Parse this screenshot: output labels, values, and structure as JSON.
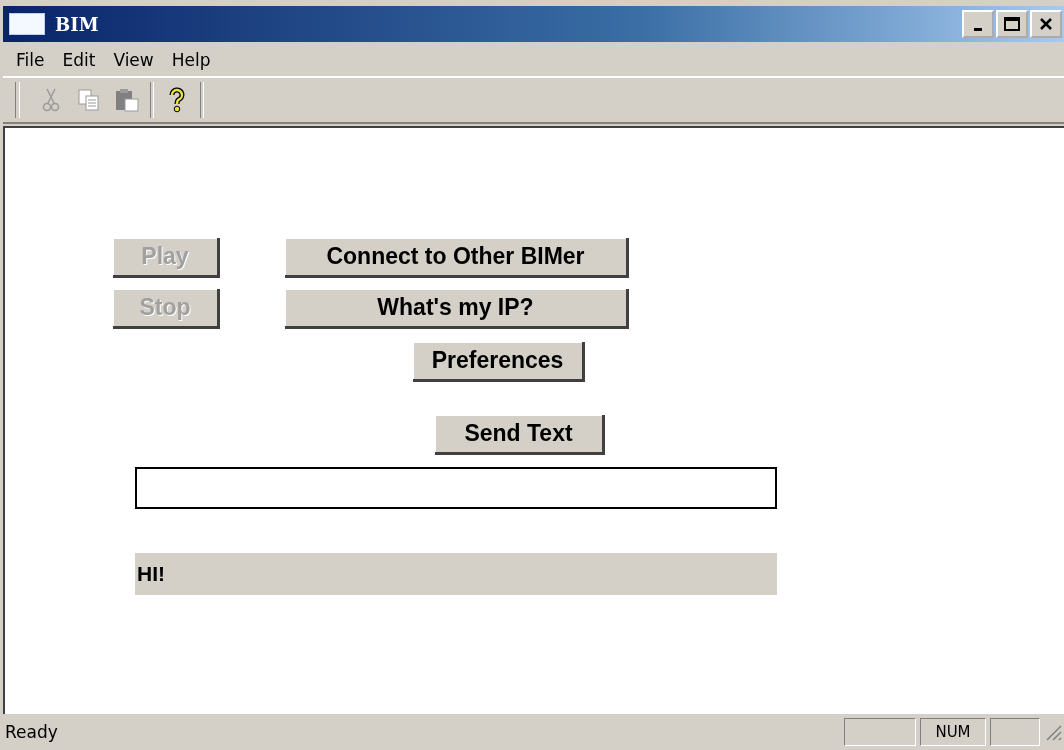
{
  "window": {
    "title": "BIM",
    "controls": [
      {
        "kind": "minimize"
      },
      {
        "kind": "maximize"
      },
      {
        "kind": "close"
      }
    ]
  },
  "menu": [
    "File",
    "Edit",
    "View",
    "Help"
  ],
  "toolbar": [
    {
      "kind": "cut",
      "disabled": true
    },
    {
      "kind": "copy",
      "disabled": true
    },
    {
      "kind": "paste",
      "disabled": true
    },
    {
      "kind": "separator"
    },
    {
      "kind": "help",
      "disabled": false
    }
  ],
  "controls": [
    {
      "label": "Play",
      "disabled": true
    },
    {
      "label": "Connect to Other BIMer",
      "disabled": false
    },
    {
      "label": "Stop",
      "disabled": true
    },
    {
      "label": "What's my IP?",
      "disabled": false
    },
    {
      "label": "Preferences",
      "disabled": false
    },
    {
      "label": "Send Text",
      "disabled": false
    }
  ],
  "output": "HI!",
  "status_bar": {
    "text": "Ready",
    "panes": [
      {
        "kind": "empty"
      },
      {
        "kind": "text",
        "text": "NUM"
      },
      {
        "kind": "empty"
      }
    ]
  }
}
